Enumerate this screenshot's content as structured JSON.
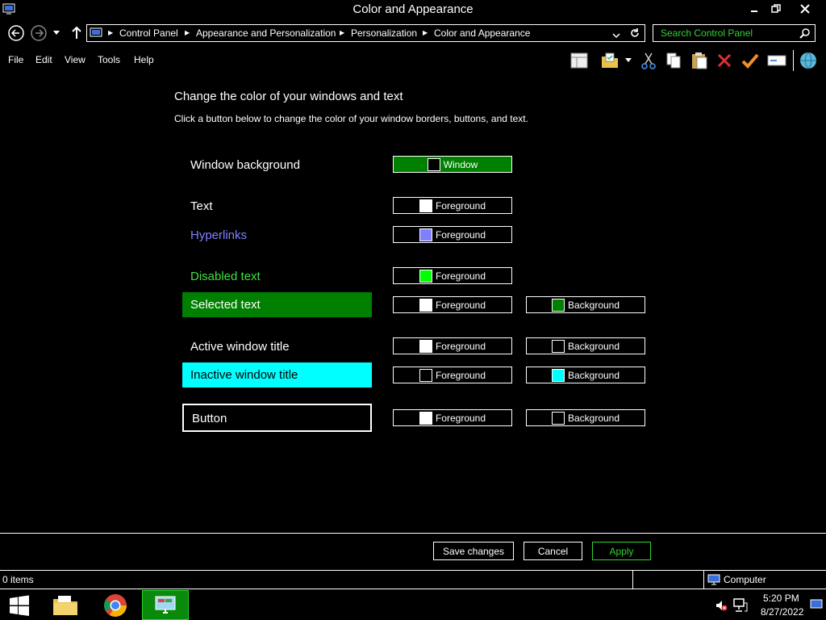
{
  "window": {
    "title": "Color and Appearance"
  },
  "address": {
    "crumbs": [
      "Control Panel",
      "Appearance and Personalization",
      "Personalization",
      "Color and Appearance"
    ]
  },
  "search": {
    "placeholder": "Search Control Panel"
  },
  "menu": {
    "file": "File",
    "edit": "Edit",
    "view": "View",
    "tools": "Tools",
    "help": "Help"
  },
  "main": {
    "heading": "Change the color of your windows and text",
    "subheading": "Click a button below to change the color of your window borders, buttons, and text."
  },
  "rows": {
    "window_background": {
      "label": "Window background",
      "fg_label": "Window"
    },
    "text": {
      "label": "Text",
      "fg_label": "Foreground"
    },
    "hyperlinks": {
      "label": "Hyperlinks",
      "fg_label": "Foreground"
    },
    "disabled_text": {
      "label": "Disabled text",
      "fg_label": "Foreground"
    },
    "selected_text": {
      "label": "Selected text",
      "fg_label": "Foreground",
      "bg_label": "Background"
    },
    "active_title": {
      "label": "Active window title",
      "fg_label": "Foreground",
      "bg_label": "Background"
    },
    "inactive_title": {
      "label": "Inactive window title",
      "fg_label": "Foreground",
      "bg_label": "Background"
    },
    "button": {
      "label": "Button",
      "fg_label": "Foreground",
      "bg_label": "Background"
    }
  },
  "colors": {
    "window_bg": "#000000",
    "text": "#ffffff",
    "hyperlink": "#8080ff",
    "disabled": "#3fe03f",
    "selected_bg": "#008000",
    "selected_fg": "#ffffff",
    "active_title_fg": "#ffffff",
    "active_title_bg": "#000000",
    "inactive_title_fg": "#000000",
    "inactive_title_bg": "#00ffff",
    "button_fg": "#ffffff",
    "button_bg": "#000000",
    "apply_accent": "#2fd42f"
  },
  "footer": {
    "save": "Save changes",
    "cancel": "Cancel",
    "apply": "Apply"
  },
  "status": {
    "items": "0 items",
    "computer": "Computer"
  },
  "clock": {
    "time": "5:20 PM",
    "date": "8/27/2022"
  }
}
